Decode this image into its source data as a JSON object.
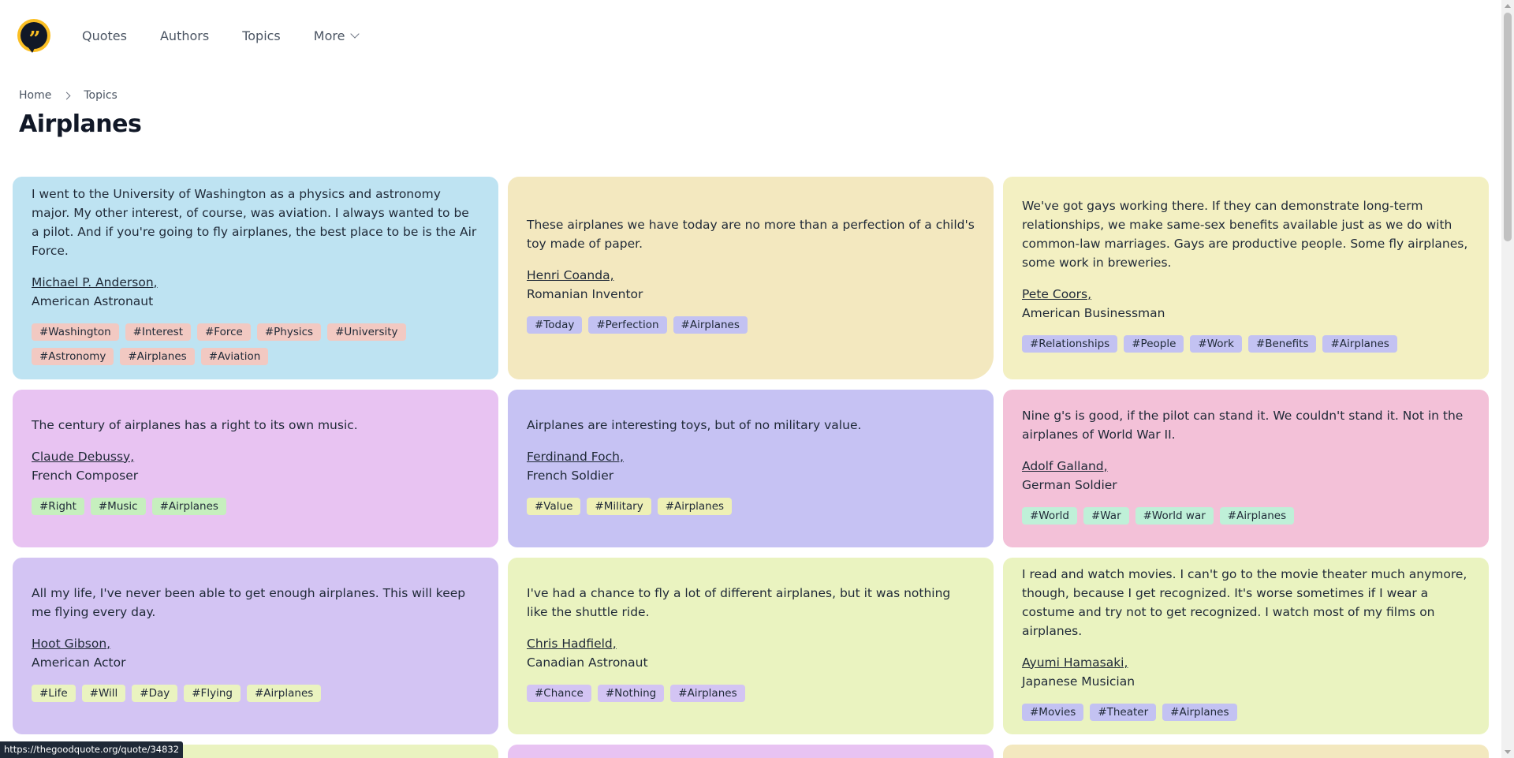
{
  "nav": {
    "logo_glyph": "”",
    "items": [
      "Quotes",
      "Authors",
      "Topics",
      "More"
    ]
  },
  "breadcrumb": [
    "Home",
    "Topics"
  ],
  "page_title": "Airplanes",
  "colors": {
    "blue": "#bee3f2",
    "sand": "#f3e8bf",
    "yellow": "#f3f0c2",
    "pink": "#e8c3f2",
    "lavender": "#c6c2f3",
    "rose": "#f3c1d8",
    "purple": "#d3c4f3",
    "lime": "#eaf3c0",
    "tag_peach": "#f2c9c2",
    "tag_blue": "#c3c2f2",
    "tag_green": "#c6efbe",
    "tag_yellow": "#eef0b6",
    "tag_mint": "#bff0d8"
  },
  "cards": [
    {
      "quote": "I went to the University of Washington as a physics and astronomy major. My other interest, of course, was aviation. I always wanted to be a pilot. And if you're going to fly airplanes, the best place to be is the Air Force.",
      "author": "Michael P. Anderson,",
      "profession": "American Astronaut",
      "tags": [
        "#Washington",
        "#Interest",
        "#Force",
        "#Physics",
        "#University",
        "#Astronomy",
        "#Airplanes",
        "#Aviation"
      ]
    },
    {
      "quote": "These airplanes we have today are no more than a perfection of a child's toy made of paper.",
      "author": "Henri Coanda,",
      "profession": "Romanian Inventor",
      "tags": [
        "#Today",
        "#Perfection",
        "#Airplanes"
      ]
    },
    {
      "quote": "We've got gays working there. If they can demonstrate long-term relationships, we make same-sex benefits available just as we do with common-law marriages. Gays are productive people. Some fly airplanes, some work in breweries.",
      "author": "Pete Coors,",
      "profession": "American Businessman",
      "tags": [
        "#Relationships",
        "#People",
        "#Work",
        "#Benefits",
        "#Airplanes"
      ]
    },
    {
      "quote": "The century of airplanes has a right to its own music.",
      "author": "Claude Debussy,",
      "profession": "French Composer",
      "tags": [
        "#Right",
        "#Music",
        "#Airplanes"
      ]
    },
    {
      "quote": "Airplanes are interesting toys, but of no military value.",
      "author": "Ferdinand Foch,",
      "profession": "French Soldier",
      "tags": [
        "#Value",
        "#Military",
        "#Airplanes"
      ]
    },
    {
      "quote": "Nine g's is good, if the pilot can stand it. We couldn't stand it. Not in the airplanes of World War II.",
      "author": "Adolf Galland,",
      "profession": "German Soldier",
      "tags": [
        "#World",
        "#War",
        "#World war",
        "#Airplanes"
      ]
    },
    {
      "quote": "All my life, I've never been able to get enough airplanes. This will keep me flying every day.",
      "author": "Hoot Gibson,",
      "profession": "American Actor",
      "tags": [
        "#Life",
        "#Will",
        "#Day",
        "#Flying",
        "#Airplanes"
      ]
    },
    {
      "quote": "I've had a chance to fly a lot of different airplanes, but it was nothing like the shuttle ride.",
      "author": "Chris Hadfield,",
      "profession": "Canadian Astronaut",
      "tags": [
        "#Chance",
        "#Nothing",
        "#Airplanes"
      ]
    },
    {
      "quote": "I read and watch movies. I can't go to the movie theater much anymore, though, because I get recognized. It's worse sometimes if I wear a costume and try not to get recognized. I watch most of my films on airplanes.",
      "author": "Ayumi Hamasaki,",
      "profession": "Japanese Musician",
      "tags": [
        "#Movies",
        "#Theater",
        "#Airplanes"
      ]
    }
  ],
  "status_url": "https://thegoodquote.org/quote/34832"
}
